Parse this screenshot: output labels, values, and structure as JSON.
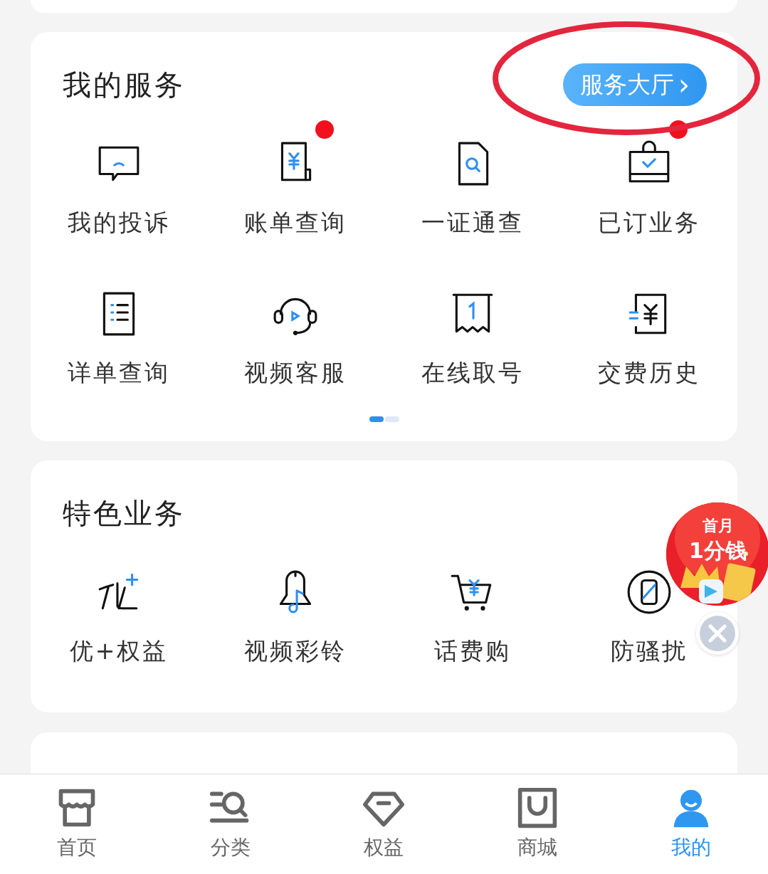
{
  "my_services": {
    "title": "我的服务",
    "hall_button": {
      "label": "服务大厅",
      "chevron": "›"
    },
    "annotated": true,
    "items": [
      {
        "label": "我的投诉",
        "badge": false
      },
      {
        "label": "账单查询",
        "badge": true
      },
      {
        "label": "一证通查",
        "badge": false
      },
      {
        "label": "已订业务",
        "badge": true
      },
      {
        "label": "详单查询",
        "badge": false
      },
      {
        "label": "视频客服",
        "badge": false
      },
      {
        "label": "在线取号",
        "badge": false
      },
      {
        "label": "交费历史",
        "badge": false
      }
    ],
    "pages": [
      {
        "selected": true
      },
      {
        "selected": false
      }
    ]
  },
  "featured": {
    "title": "特色业务",
    "items": [
      {
        "label": "优+权益"
      },
      {
        "label": "视频彩铃"
      },
      {
        "label": "话费购"
      },
      {
        "label": "防骚扰"
      }
    ]
  },
  "promo": {
    "line_1": "首月",
    "line_2": "1分钱"
  },
  "tab_bar": [
    {
      "label": "首页",
      "selected": false
    },
    {
      "label": "分类",
      "selected": false
    },
    {
      "label": "权益",
      "selected": false
    },
    {
      "label": "商城",
      "selected": false
    },
    {
      "label": "我的",
      "selected": true
    }
  ]
}
